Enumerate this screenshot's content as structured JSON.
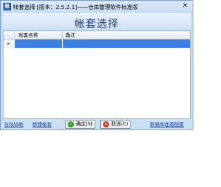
{
  "window": {
    "app_icon_text": "账",
    "title": "帐套选择 [版本：2.5.2.1]——仓库管理软件标准版",
    "close_glyph": "✕"
  },
  "dialog": {
    "heading": "帐套选择"
  },
  "grid": {
    "columns": [
      "帐套名称",
      "备注"
    ],
    "current_row_marker": "▸",
    "rows": [
      {
        "name": "",
        "remark": ""
      }
    ]
  },
  "footer": {
    "online_help": "在线协助",
    "new_account": "新建帐套",
    "ok_label": "确定(S)",
    "cancel_label": "取消(C)",
    "db_config": "数据库连接配置"
  },
  "colors": {
    "ok_icon": "#3a9d2b",
    "cancel_icon": "#d13b2e",
    "selection": "#3d7fe0"
  },
  "icons": {
    "ok": "check-icon",
    "cancel": "cancel-icon"
  }
}
